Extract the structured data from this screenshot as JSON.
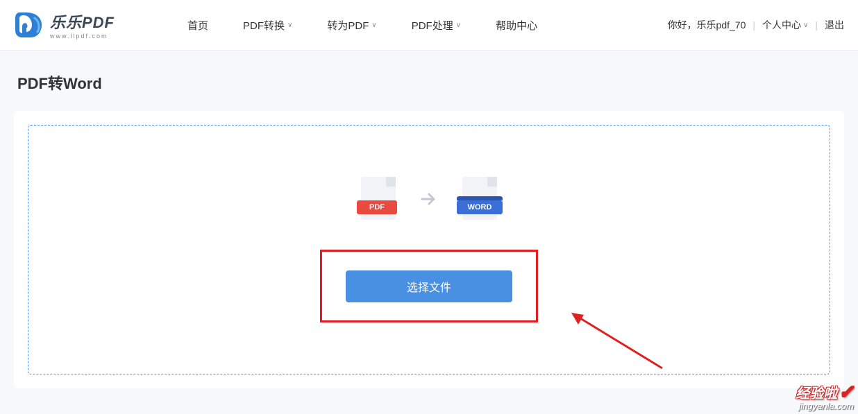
{
  "logo": {
    "main_text": "乐乐PDF",
    "sub_text": "www.llpdf.com"
  },
  "nav": {
    "home": "首页",
    "pdf_convert": "PDF转换",
    "to_pdf": "转为PDF",
    "pdf_process": "PDF处理",
    "help": "帮助中心"
  },
  "user": {
    "greeting": "你好，乐乐pdf_70",
    "center": "个人中心",
    "logout": "退出"
  },
  "page": {
    "title": "PDF转Word"
  },
  "dropzone": {
    "pdf_badge": "PDF",
    "word_badge": "WORD",
    "select_button": "选择文件"
  },
  "watermark": {
    "top": "经验啦",
    "sub": "jingyanla.com"
  }
}
